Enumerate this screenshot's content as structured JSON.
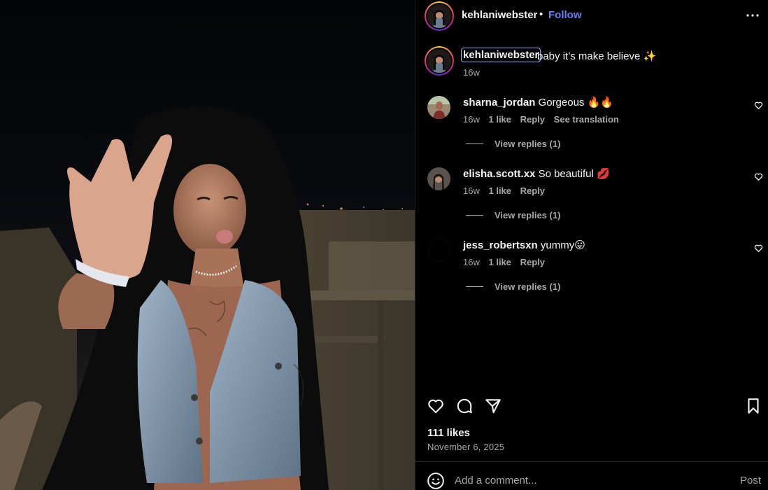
{
  "post": {
    "username": "kehlaniwebster",
    "separator": "•",
    "follow_label": "Follow",
    "caption": {
      "username": "kehlaniwebster",
      "text": "baby it’s make believe ✨",
      "time": "16w"
    },
    "likes": "111 likes",
    "date": "November 6, 2025"
  },
  "comments": [
    {
      "username": "sharna_jordan",
      "text": "Gorgeous 🔥🔥",
      "time": "16w",
      "likes": "1 like",
      "reply_label": "Reply",
      "translate_label": "See translation",
      "replies_label": "View replies (1)",
      "avatar_color": "#8a6a55"
    },
    {
      "username": "elisha.scott.xx",
      "text": "So beautiful 💋",
      "time": "16w",
      "likes": "1 like",
      "reply_label": "Reply",
      "replies_label": "View replies (1)",
      "avatar_color": "#6b5e58"
    },
    {
      "username": "jess_robertsxn",
      "text": "yummy😛",
      "time": "16w",
      "likes": "1 like",
      "reply_label": "Reply",
      "replies_label": "View replies (1)",
      "avatar_color": "#000000"
    }
  ],
  "comment_box": {
    "placeholder": "Add a comment...",
    "post_label": "Post"
  },
  "icons": {
    "more": "more-horizontal-icon",
    "like": "heart-icon",
    "comment": "comment-bubble-icon",
    "share": "send-icon",
    "save": "bookmark-icon",
    "emoji": "emoji-icon"
  },
  "colors": {
    "accent": "#6b7ff8",
    "secondary_text": "#a8a8a8",
    "background": "#000000"
  }
}
